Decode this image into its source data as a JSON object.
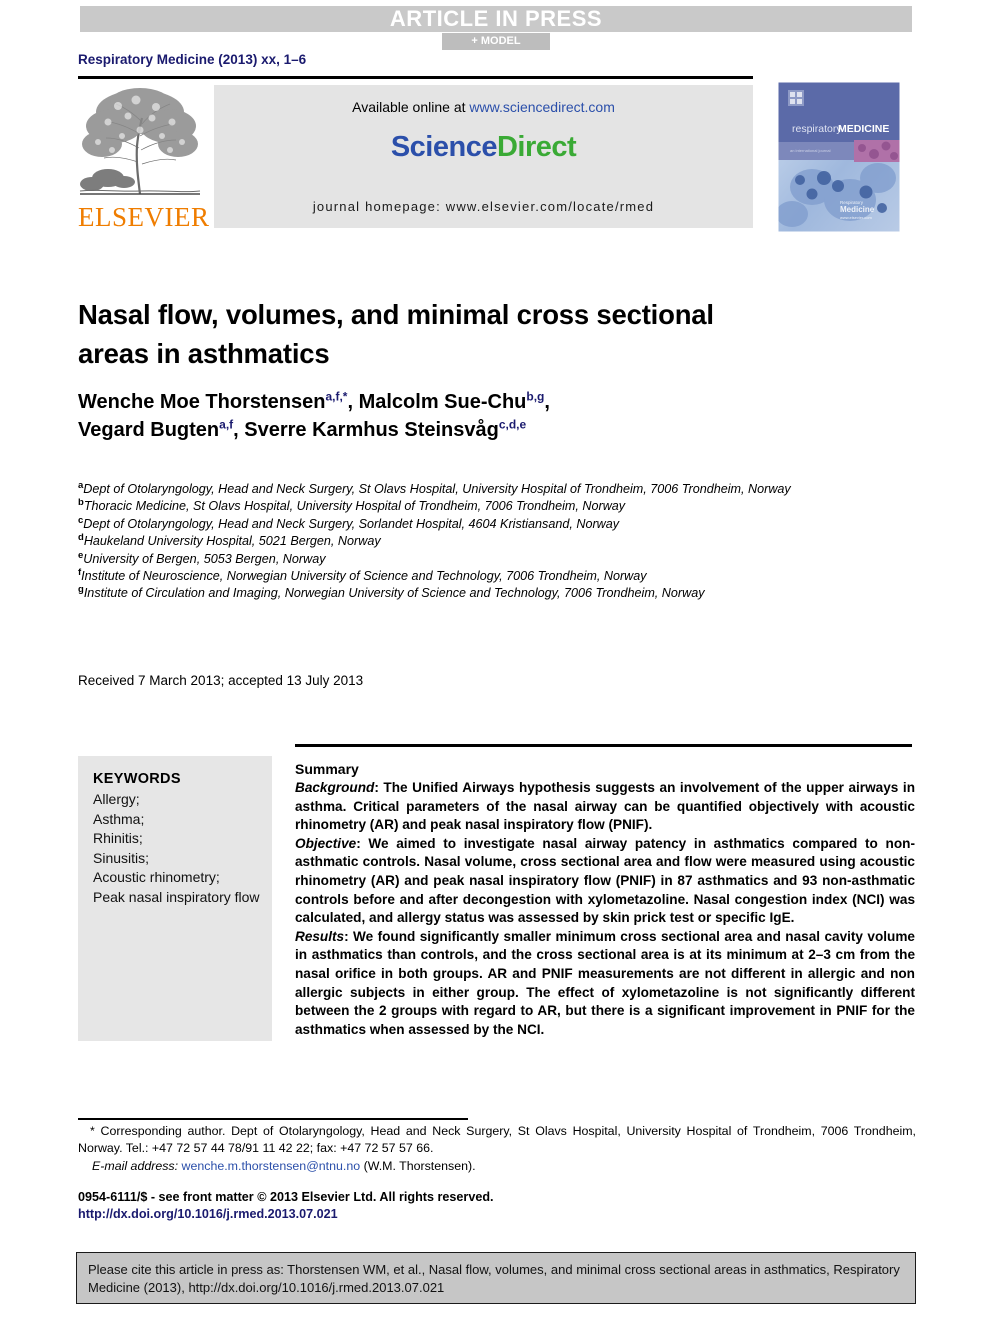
{
  "banner": {
    "article_in_press": "ARTICLE IN PRESS",
    "model_label": "+ MODEL"
  },
  "journal_line": "Respiratory Medicine (2013) xx, 1–6",
  "header": {
    "available_online_prefix": "Available online at ",
    "sciencedirect_url": "www.sciencedirect.com",
    "wordmark_part1": "Science",
    "wordmark_part2": "Direct",
    "journal_homepage": "journal homepage: www.elsevier.com/locate/rmed",
    "elsevier_wordmark": "ELSEVIER",
    "cover": {
      "journal_name_light": "respiratory",
      "journal_name_bold": "MEDICINE",
      "subtitle": "an international journal",
      "overlay_title": "Respiratory Medicine"
    }
  },
  "title": "Nasal flow, volumes, and minimal cross sectional areas in asthmatics",
  "authors": [
    {
      "name": "Wenche Moe Thorstensen",
      "marks": "a,f,*",
      "sep": ", "
    },
    {
      "name": "Malcolm Sue-Chu",
      "marks": "b,g",
      "sep": ","
    },
    {
      "name": "Vegard Bugten",
      "marks": "a,f",
      "sep": ", "
    },
    {
      "name": "Sverre Karmhus Steinsvåg",
      "marks": "c,d,e",
      "sep": ""
    }
  ],
  "affiliations": [
    {
      "mark": "a",
      "text": "Dept of Otolaryngology, Head and Neck Surgery, St Olavs Hospital, University Hospital of Trondheim, 7006 Trondheim, Norway"
    },
    {
      "mark": "b",
      "text": "Thoracic Medicine, St Olavs Hospital, University Hospital of Trondheim, 7006 Trondheim, Norway"
    },
    {
      "mark": "c",
      "text": "Dept of Otolaryngology, Head and Neck Surgery, Sorlandet Hospital, 4604 Kristiansand, Norway"
    },
    {
      "mark": "d",
      "text": "Haukeland University Hospital, 5021 Bergen, Norway"
    },
    {
      "mark": "e",
      "text": "University of Bergen, 5053 Bergen, Norway"
    },
    {
      "mark": "f",
      "text": "Institute of Neuroscience, Norwegian University of Science and Technology, 7006 Trondheim, Norway"
    },
    {
      "mark": "g",
      "text": "Institute of Circulation and Imaging, Norwegian University of Science and Technology, 7006 Trondheim, Norway"
    }
  ],
  "received_line": "Received 7 March 2013; accepted 13 July 2013",
  "keywords": {
    "heading": "KEYWORDS",
    "items": [
      "Allergy;",
      "Asthma;",
      "Rhinitis;",
      "Sinusitis;",
      "Acoustic rhinometry;",
      "Peak nasal inspiratory flow"
    ]
  },
  "summary": {
    "heading": "Summary",
    "sections": [
      {
        "label": "Background",
        "text": ": The Unified Airways hypothesis suggests an involvement of the upper airways in asthma. Critical parameters of the nasal airway can be quantified objectively with acoustic rhinometry (AR) and peak nasal inspiratory flow (PNIF)."
      },
      {
        "label": "Objective",
        "text": ": We aimed to investigate nasal airway patency in asthmatics compared to non-asthmatic controls. Nasal volume, cross sectional area and flow were measured using acoustic rhinometry (AR) and peak nasal inspiratory flow (PNIF) in 87 asthmatics and 93 non-asthmatic controls before and after decongestion with xylometazoline. Nasal congestion index (NCI) was calculated, and allergy status was assessed by skin prick test or specific IgE."
      },
      {
        "label": "Results",
        "text": ": We found significantly smaller minimum cross sectional area and nasal cavity volume in asthmatics than controls, and the cross sectional area is at its minimum at 2–3 cm from the nasal orifice in both groups. AR and PNIF measurements are not different in allergic and non allergic subjects in either group. The effect of xylometazoline is not significantly different between the 2 groups with regard to AR, but there is a significant improvement in PNIF for the asthmatics when assessed by the NCI."
      }
    ]
  },
  "footnotes": {
    "corresponding": "* Corresponding author. Dept of Otolaryngology, Head and Neck Surgery, St Olavs Hospital, University Hospital of Trondheim, 7006 Trondheim, Norway. Tel.: +47 72 57 44 78/91 11 42 22; fax: +47 72 57 57 66.",
    "email_label": "E-mail address:",
    "email_address": "wenche.m.thorstensen@ntnu.no",
    "email_suffix": "(W.M. Thorstensen)."
  },
  "copyright": {
    "line1": "0954-6111/$ - see front matter © 2013 Elsevier Ltd. All rights reserved.",
    "doi": "http://dx.doi.org/10.1016/j.rmed.2013.07.021"
  },
  "citation_box": {
    "text": "Please cite this article in press as: Thorstensen WM, et al., Nasal flow, volumes, and minimal cross sectional areas in asthmatics, Respiratory Medicine (2013), http://dx.doi.org/10.1016/j.rmed.2013.07.021"
  },
  "colors": {
    "journal_blue": "#1a1a6e",
    "link_blue": "#2b4faa",
    "sciencedirect_green": "#3aaa35",
    "elsevier_orange": "#ef7d00",
    "banner_grey": "#c9c9c9"
  }
}
